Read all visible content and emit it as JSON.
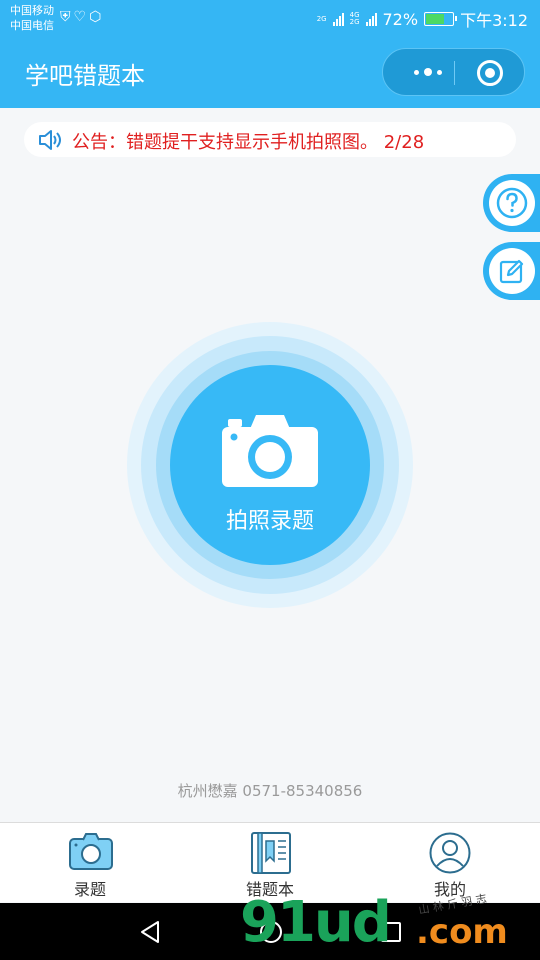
{
  "status_bar": {
    "carrier_1": "中国移动",
    "carrier_2": "中国电信",
    "net_1": "2G",
    "net_2": "4G",
    "net_3": "2G",
    "battery": "72%",
    "battery_level": 0.72,
    "time": "下午3:12"
  },
  "nav": {
    "title": "学吧错题本"
  },
  "notice": {
    "text": "公告：错题提干支持显示手机拍照图。 2/28"
  },
  "camera": {
    "label": "拍照录题"
  },
  "footer": {
    "contact": "杭州懋嘉 0571-85340856"
  },
  "tabs": [
    {
      "label": "录题"
    },
    {
      "label": "错题本"
    },
    {
      "label": "我的"
    }
  ],
  "watermark": {
    "main": "91ud",
    "suffix": ".com",
    "small": "山 林 斤 羽 志"
  },
  "colors": {
    "primary": "#35b6f4",
    "notice_text": "#e02020",
    "tab_icon": "#2c6d8f"
  }
}
